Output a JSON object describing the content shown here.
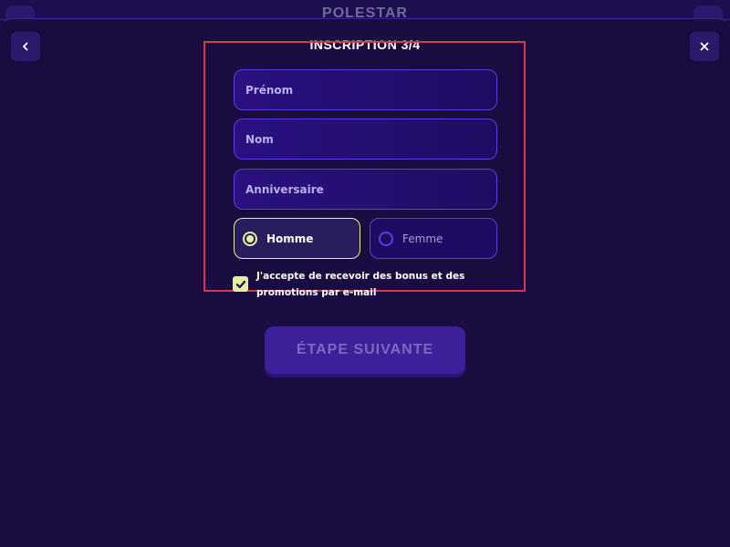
{
  "background_app": {
    "logo": "POLESTAR"
  },
  "modal": {
    "title": "INSCRIPTION 3/4",
    "back_icon": "chevron-left-icon",
    "close_icon": "close-icon"
  },
  "form": {
    "first_name": {
      "placeholder": "Prénom",
      "value": ""
    },
    "last_name": {
      "placeholder": "Nom",
      "value": ""
    },
    "birthday": {
      "placeholder": "Anniversaire",
      "value": ""
    },
    "gender": {
      "options": [
        {
          "label": "Homme",
          "selected": true
        },
        {
          "label": "Femme",
          "selected": false
        }
      ]
    },
    "consent": {
      "checked": true,
      "label": "J'accepte de recevoir des bonus et des promotions par e-mail"
    },
    "next_button": "ÉTAPE SUIVANTE"
  },
  "colors": {
    "background": "#180c40",
    "field_border": "#5a3fe0",
    "accent": "#e6ef9c",
    "highlight_box": "#d23c4a",
    "button": "#3d1f9a"
  }
}
